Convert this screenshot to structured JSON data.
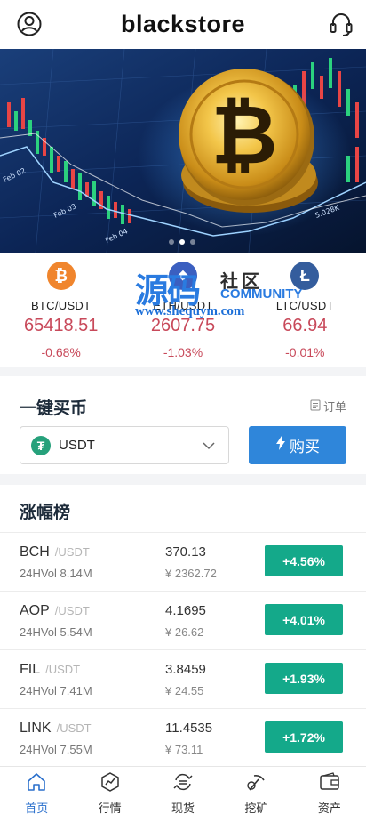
{
  "header": {
    "title": "blackstore",
    "left_icon": "user-circle-icon",
    "right_icon": "headset-icon"
  },
  "banner": {
    "slides": 3,
    "active_slide": 1,
    "chart_labels": [
      "Feb 02",
      "Feb 03",
      "Feb 04",
      "5.028K"
    ]
  },
  "tickers": [
    {
      "pair": "BTC/USDT",
      "price": "65418.51",
      "change": "-0.68%",
      "icon": "btc-icon",
      "icon_glyph": "₿",
      "color": "#f0852d"
    },
    {
      "pair": "ETH/USDT",
      "price": "2607.75",
      "change": "-1.03%",
      "icon": "eth-icon",
      "icon_glyph": "⬥",
      "color": "#3b5fc0"
    },
    {
      "pair": "LTC/USDT",
      "price": "66.94",
      "change": "-0.01%",
      "icon": "ltc-icon",
      "icon_glyph": "Ł",
      "color": "#345d9d"
    }
  ],
  "watermark": {
    "big": "源码",
    "cn": "社区",
    "en": "COMMUNITY",
    "url": "www.shequym.com"
  },
  "buy": {
    "title": "一键买币",
    "orders_label": "订单",
    "selected_coin": "USDT",
    "button_label": "购买"
  },
  "ranking": {
    "title": "涨幅榜",
    "rows": [
      {
        "symbol": "BCH",
        "quote": "/USDT",
        "volume": "24HVol 8.14M",
        "price": "370.13",
        "cny": "¥ 2362.72",
        "change": "+4.56%"
      },
      {
        "symbol": "AOP",
        "quote": "/USDT",
        "volume": "24HVol 5.54M",
        "price": "4.1695",
        "cny": "¥ 26.62",
        "change": "+4.01%"
      },
      {
        "symbol": "FIL",
        "quote": "/USDT",
        "volume": "24HVol 7.41M",
        "price": "3.8459",
        "cny": "¥ 24.55",
        "change": "+1.93%"
      },
      {
        "symbol": "LINK",
        "quote": "/USDT",
        "volume": "24HVol 7.55M",
        "price": "11.4535",
        "cny": "¥ 73.11",
        "change": "+1.72%"
      }
    ]
  },
  "tabbar": [
    {
      "label": "首页",
      "icon": "home-icon",
      "active": true
    },
    {
      "label": "行情",
      "icon": "market-icon",
      "active": false
    },
    {
      "label": "现货",
      "icon": "spot-exchange-icon",
      "active": false
    },
    {
      "label": "挖矿",
      "icon": "mining-icon",
      "active": false
    },
    {
      "label": "资产",
      "icon": "wallet-icon",
      "active": false
    }
  ],
  "colors": {
    "down": "#c8495a",
    "up": "#14a98a",
    "primary": "#2f86da",
    "tab_active": "#2a6fcc"
  }
}
